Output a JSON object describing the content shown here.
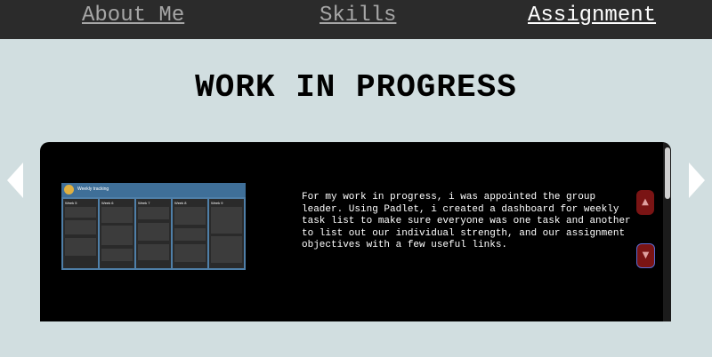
{
  "nav": {
    "items": [
      {
        "label": "About Me",
        "active": false
      },
      {
        "label": "Skills",
        "active": false
      },
      {
        "label": "Assignment",
        "active": true
      }
    ]
  },
  "page": {
    "title": "WORK IN PROGRESS"
  },
  "panel": {
    "thumbnail": {
      "header_title": "Weekly tracking",
      "columns": [
        "Week 5",
        "Week 6",
        "Week 7",
        "Week 8",
        "Week 9"
      ]
    },
    "description": "For my work in progress, i was appointed the group leader. Using Padlet, i created a dashboard for weekly task list to make sure everyone was one task and another to list out our individual strength, and our assignment objectives with a few useful links."
  },
  "icons": {
    "prev": "triangle-left-icon",
    "next": "triangle-right-icon",
    "up": "chevron-up-icon",
    "down": "chevron-down-icon"
  },
  "colors": {
    "nav_bg": "#2b2b2b",
    "page_bg": "#d1dee0",
    "panel_bg": "#000000",
    "button_bg": "#7a1414"
  }
}
